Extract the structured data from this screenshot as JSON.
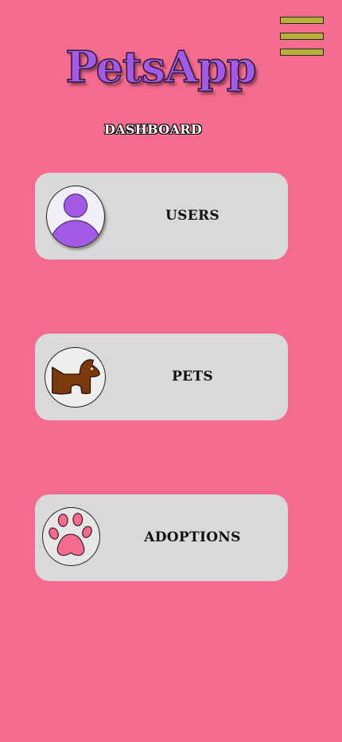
{
  "app": {
    "title": "PetsApp"
  },
  "header": {
    "menu_icon": "hamburger-menu-icon"
  },
  "page": {
    "section_title": "DASHBOARD"
  },
  "cards": [
    {
      "label": "USERS",
      "icon": "user-avatar-icon"
    },
    {
      "label": "PETS",
      "icon": "dog-icon"
    },
    {
      "label": "ADOPTIONS",
      "icon": "paw-print-icon"
    }
  ],
  "colors": {
    "background": "#f36b8e",
    "card": "#d9d9d9",
    "brand_purple": "#a35ae4",
    "menu_bar": "#b6b13c",
    "dog_brown": "#7a3a0e",
    "paw_pink": "#f36b8e"
  }
}
